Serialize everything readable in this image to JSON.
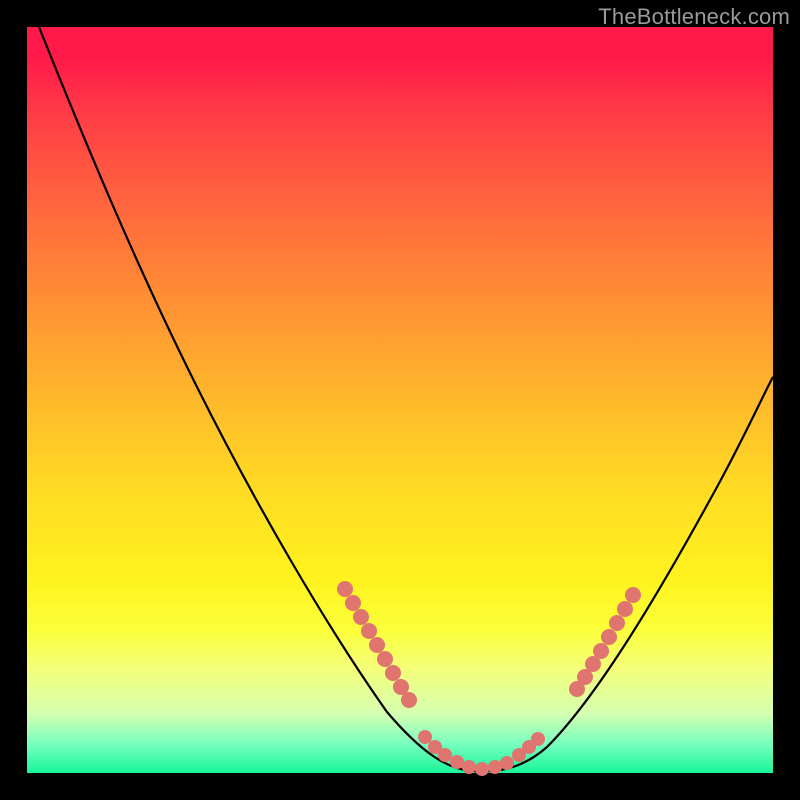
{
  "watermark": "TheBottleneck.com",
  "colors": {
    "background": "#000000",
    "curve": "#000000",
    "marker": "#e0746f",
    "gradient_top": "#ff1a49",
    "gradient_bottom": "#17f59a"
  },
  "chart_data": {
    "type": "line",
    "title": "",
    "xlabel": "",
    "ylabel": "",
    "xlim": [
      0,
      100
    ],
    "ylim": [
      0,
      100
    ],
    "grid": false,
    "legend": false,
    "series": [
      {
        "name": "bottleneck-curve",
        "x": [
          0,
          5,
          10,
          15,
          20,
          25,
          30,
          35,
          40,
          45,
          50,
          55,
          58,
          60,
          62,
          65,
          70,
          75,
          80,
          85,
          90,
          95,
          100
        ],
        "y": [
          100,
          92,
          83,
          74,
          65,
          56,
          47,
          38,
          29,
          20,
          12,
          6,
          3,
          1,
          0,
          1,
          4,
          10,
          18,
          27,
          36,
          45,
          53
        ]
      }
    ],
    "markers": {
      "left_cluster_x": [
        42,
        44,
        46,
        48,
        50,
        52
      ],
      "left_cluster_y": [
        25,
        22,
        19,
        16,
        13,
        10
      ],
      "valley_cluster_x": [
        55,
        57,
        59,
        60,
        61,
        63,
        65,
        67
      ],
      "valley_cluster_y": [
        5,
        3,
        1,
        0,
        0,
        1,
        1.5,
        2.5
      ],
      "right_cluster_x": [
        72,
        74,
        76,
        78,
        80,
        82
      ],
      "right_cluster_y": [
        8,
        11,
        14,
        17,
        20,
        23
      ]
    }
  }
}
